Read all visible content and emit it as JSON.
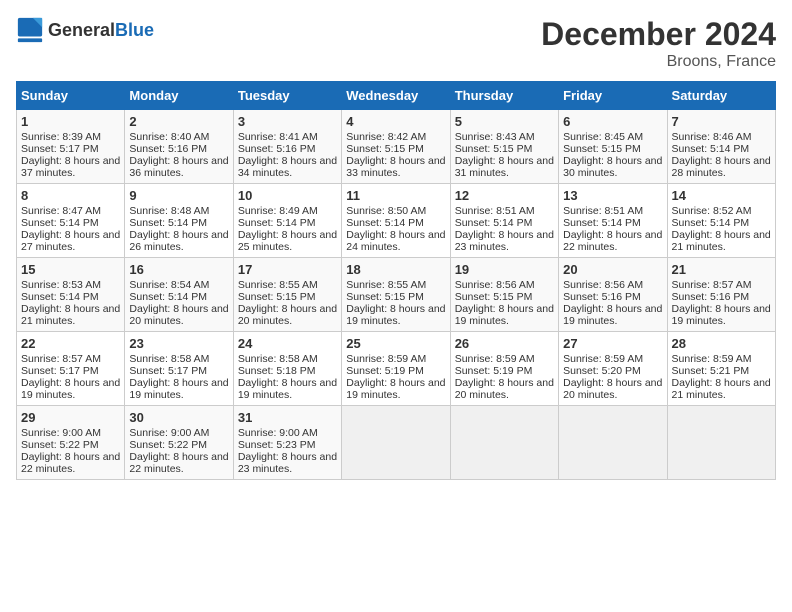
{
  "header": {
    "logo_general": "General",
    "logo_blue": "Blue",
    "title": "December 2024",
    "subtitle": "Broons, France"
  },
  "columns": [
    "Sunday",
    "Monday",
    "Tuesday",
    "Wednesday",
    "Thursday",
    "Friday",
    "Saturday"
  ],
  "weeks": [
    [
      {
        "day": "1",
        "sunrise": "Sunrise: 8:39 AM",
        "sunset": "Sunset: 5:17 PM",
        "daylight": "Daylight: 8 hours and 37 minutes."
      },
      {
        "day": "2",
        "sunrise": "Sunrise: 8:40 AM",
        "sunset": "Sunset: 5:16 PM",
        "daylight": "Daylight: 8 hours and 36 minutes."
      },
      {
        "day": "3",
        "sunrise": "Sunrise: 8:41 AM",
        "sunset": "Sunset: 5:16 PM",
        "daylight": "Daylight: 8 hours and 34 minutes."
      },
      {
        "day": "4",
        "sunrise": "Sunrise: 8:42 AM",
        "sunset": "Sunset: 5:15 PM",
        "daylight": "Daylight: 8 hours and 33 minutes."
      },
      {
        "day": "5",
        "sunrise": "Sunrise: 8:43 AM",
        "sunset": "Sunset: 5:15 PM",
        "daylight": "Daylight: 8 hours and 31 minutes."
      },
      {
        "day": "6",
        "sunrise": "Sunrise: 8:45 AM",
        "sunset": "Sunset: 5:15 PM",
        "daylight": "Daylight: 8 hours and 30 minutes."
      },
      {
        "day": "7",
        "sunrise": "Sunrise: 8:46 AM",
        "sunset": "Sunset: 5:14 PM",
        "daylight": "Daylight: 8 hours and 28 minutes."
      }
    ],
    [
      {
        "day": "8",
        "sunrise": "Sunrise: 8:47 AM",
        "sunset": "Sunset: 5:14 PM",
        "daylight": "Daylight: 8 hours and 27 minutes."
      },
      {
        "day": "9",
        "sunrise": "Sunrise: 8:48 AM",
        "sunset": "Sunset: 5:14 PM",
        "daylight": "Daylight: 8 hours and 26 minutes."
      },
      {
        "day": "10",
        "sunrise": "Sunrise: 8:49 AM",
        "sunset": "Sunset: 5:14 PM",
        "daylight": "Daylight: 8 hours and 25 minutes."
      },
      {
        "day": "11",
        "sunrise": "Sunrise: 8:50 AM",
        "sunset": "Sunset: 5:14 PM",
        "daylight": "Daylight: 8 hours and 24 minutes."
      },
      {
        "day": "12",
        "sunrise": "Sunrise: 8:51 AM",
        "sunset": "Sunset: 5:14 PM",
        "daylight": "Daylight: 8 hours and 23 minutes."
      },
      {
        "day": "13",
        "sunrise": "Sunrise: 8:51 AM",
        "sunset": "Sunset: 5:14 PM",
        "daylight": "Daylight: 8 hours and 22 minutes."
      },
      {
        "day": "14",
        "sunrise": "Sunrise: 8:52 AM",
        "sunset": "Sunset: 5:14 PM",
        "daylight": "Daylight: 8 hours and 21 minutes."
      }
    ],
    [
      {
        "day": "15",
        "sunrise": "Sunrise: 8:53 AM",
        "sunset": "Sunset: 5:14 PM",
        "daylight": "Daylight: 8 hours and 21 minutes."
      },
      {
        "day": "16",
        "sunrise": "Sunrise: 8:54 AM",
        "sunset": "Sunset: 5:14 PM",
        "daylight": "Daylight: 8 hours and 20 minutes."
      },
      {
        "day": "17",
        "sunrise": "Sunrise: 8:55 AM",
        "sunset": "Sunset: 5:15 PM",
        "daylight": "Daylight: 8 hours and 20 minutes."
      },
      {
        "day": "18",
        "sunrise": "Sunrise: 8:55 AM",
        "sunset": "Sunset: 5:15 PM",
        "daylight": "Daylight: 8 hours and 19 minutes."
      },
      {
        "day": "19",
        "sunrise": "Sunrise: 8:56 AM",
        "sunset": "Sunset: 5:15 PM",
        "daylight": "Daylight: 8 hours and 19 minutes."
      },
      {
        "day": "20",
        "sunrise": "Sunrise: 8:56 AM",
        "sunset": "Sunset: 5:16 PM",
        "daylight": "Daylight: 8 hours and 19 minutes."
      },
      {
        "day": "21",
        "sunrise": "Sunrise: 8:57 AM",
        "sunset": "Sunset: 5:16 PM",
        "daylight": "Daylight: 8 hours and 19 minutes."
      }
    ],
    [
      {
        "day": "22",
        "sunrise": "Sunrise: 8:57 AM",
        "sunset": "Sunset: 5:17 PM",
        "daylight": "Daylight: 8 hours and 19 minutes."
      },
      {
        "day": "23",
        "sunrise": "Sunrise: 8:58 AM",
        "sunset": "Sunset: 5:17 PM",
        "daylight": "Daylight: 8 hours and 19 minutes."
      },
      {
        "day": "24",
        "sunrise": "Sunrise: 8:58 AM",
        "sunset": "Sunset: 5:18 PM",
        "daylight": "Daylight: 8 hours and 19 minutes."
      },
      {
        "day": "25",
        "sunrise": "Sunrise: 8:59 AM",
        "sunset": "Sunset: 5:19 PM",
        "daylight": "Daylight: 8 hours and 19 minutes."
      },
      {
        "day": "26",
        "sunrise": "Sunrise: 8:59 AM",
        "sunset": "Sunset: 5:19 PM",
        "daylight": "Daylight: 8 hours and 20 minutes."
      },
      {
        "day": "27",
        "sunrise": "Sunrise: 8:59 AM",
        "sunset": "Sunset: 5:20 PM",
        "daylight": "Daylight: 8 hours and 20 minutes."
      },
      {
        "day": "28",
        "sunrise": "Sunrise: 8:59 AM",
        "sunset": "Sunset: 5:21 PM",
        "daylight": "Daylight: 8 hours and 21 minutes."
      }
    ],
    [
      {
        "day": "29",
        "sunrise": "Sunrise: 9:00 AM",
        "sunset": "Sunset: 5:22 PM",
        "daylight": "Daylight: 8 hours and 22 minutes."
      },
      {
        "day": "30",
        "sunrise": "Sunrise: 9:00 AM",
        "sunset": "Sunset: 5:22 PM",
        "daylight": "Daylight: 8 hours and 22 minutes."
      },
      {
        "day": "31",
        "sunrise": "Sunrise: 9:00 AM",
        "sunset": "Sunset: 5:23 PM",
        "daylight": "Daylight: 8 hours and 23 minutes."
      },
      null,
      null,
      null,
      null
    ]
  ]
}
